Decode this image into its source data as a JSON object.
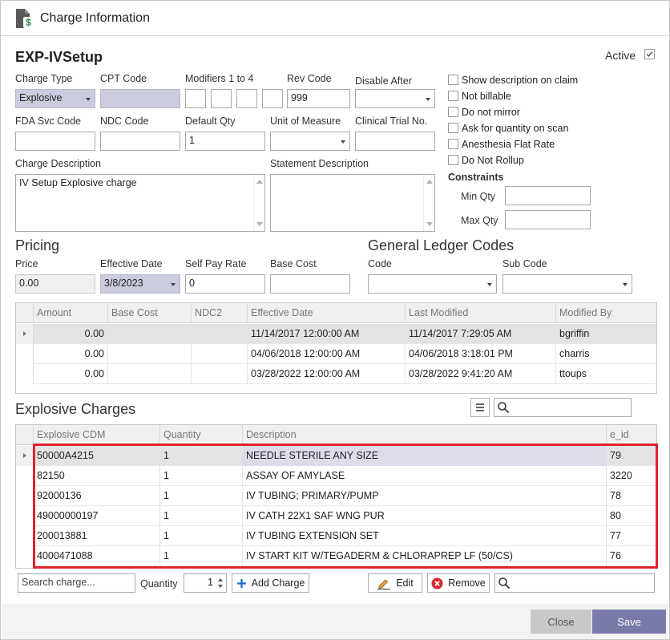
{
  "window": {
    "title": "Charge Information",
    "doc_icon": "document-dollar-icon"
  },
  "header": {
    "code": "EXP-IVSetup",
    "active_label": "Active",
    "active_checked": true
  },
  "fields": {
    "charge_type": {
      "label": "Charge Type",
      "value": "Explosive"
    },
    "cpt_code": {
      "label": "CPT Code",
      "value": ""
    },
    "modifiers": {
      "label": "Modifiers 1 to 4",
      "values": [
        "",
        "",
        "",
        ""
      ]
    },
    "rev_code": {
      "label": "Rev Code",
      "value": "999"
    },
    "disable_after": {
      "label": "Disable After",
      "value": ""
    },
    "fda_svc_code": {
      "label": "FDA Svc Code",
      "value": ""
    },
    "ndc_code": {
      "label": "NDC Code",
      "value": ""
    },
    "default_qty": {
      "label": "Default Qty",
      "value": "1"
    },
    "unit_of_measure": {
      "label": "Unit of Measure",
      "value": ""
    },
    "clinical_trial_no": {
      "label": "Clinical Trial No.",
      "value": ""
    },
    "charge_description": {
      "label": "Charge Description",
      "value": "IV Setup Explosive charge"
    },
    "statement_description": {
      "label": "Statement Description",
      "value": ""
    }
  },
  "options": [
    {
      "label": "Show description on claim",
      "checked": false
    },
    {
      "label": "Not billable",
      "checked": false
    },
    {
      "label": "Do not mirror",
      "checked": false
    },
    {
      "label": "Ask for quantity on scan",
      "checked": false
    },
    {
      "label": "Anesthesia Flat Rate",
      "checked": false
    },
    {
      "label": "Do Not Rollup",
      "checked": false
    }
  ],
  "constraints": {
    "title": "Constraints",
    "min_label": "Min Qty",
    "min_value": "",
    "max_label": "Max Qty",
    "max_value": ""
  },
  "pricing": {
    "title": "Pricing",
    "price_label": "Price",
    "price_value": "0.00",
    "effective_label": "Effective Date",
    "effective_value": "3/8/2023",
    "selfpay_label": "Self Pay Rate",
    "selfpay_value": "0",
    "basecost_label": "Base Cost",
    "basecost_value": ""
  },
  "gl": {
    "title": "General Ledger Codes",
    "code_label": "Code",
    "code_value": "",
    "subcode_label": "Sub Code",
    "subcode_value": ""
  },
  "price_history": {
    "columns": [
      "Amount",
      "Base Cost",
      "NDC2",
      "Effective Date",
      "Last Modified",
      "Modified By"
    ],
    "rows": [
      [
        "0.00",
        "",
        "",
        "11/14/2017 12:00:00 AM",
        "11/14/2017 7:29:05 AM",
        "bgriffin"
      ],
      [
        "0.00",
        "",
        "",
        "04/06/2018 12:00:00 AM",
        "04/06/2018 3:18:01 PM",
        "charris"
      ],
      [
        "0.00",
        "",
        "",
        "03/28/2022 12:00:00 AM",
        "03/28/2022 9:41:20 AM",
        "ttoups"
      ]
    ]
  },
  "explosive": {
    "title": "Explosive Charges",
    "search_value": "",
    "columns": [
      "Explosive CDM",
      "Quantity",
      "Description",
      "e_id"
    ],
    "rows": [
      [
        "50000A4215",
        "1",
        "NEEDLE STERILE ANY SIZE",
        "79"
      ],
      [
        "82150",
        "1",
        "ASSAY OF AMYLASE",
        "3220"
      ],
      [
        "92000136",
        "1",
        "IV TUBING; PRIMARY/PUMP",
        "78"
      ],
      [
        "49000000197",
        "1",
        "IV CATH 22X1 SAF WNG PUR",
        "80"
      ],
      [
        "200013881",
        "1",
        "IV TUBING EXTENSION SET",
        "77"
      ],
      [
        "4000471088",
        "1",
        "IV START KIT W/TEGADERM & CHLORAPREP LF (50/CS)",
        "76"
      ]
    ]
  },
  "toolbar": {
    "search_placeholder": "Search charge...",
    "quantity_label": "Quantity",
    "quantity_value": "1",
    "add_label": "Add Charge",
    "edit_label": "Edit",
    "remove_label": "Remove",
    "filter_value": ""
  },
  "footer": {
    "close_label": "Close",
    "save_label": "Save"
  },
  "colors": {
    "highlight": "#e0232e",
    "save_button": "#7a7aaa",
    "close_button": "#c8c8c8",
    "add_icon": "#1e6fd0",
    "remove_icon": "#d9262f"
  }
}
